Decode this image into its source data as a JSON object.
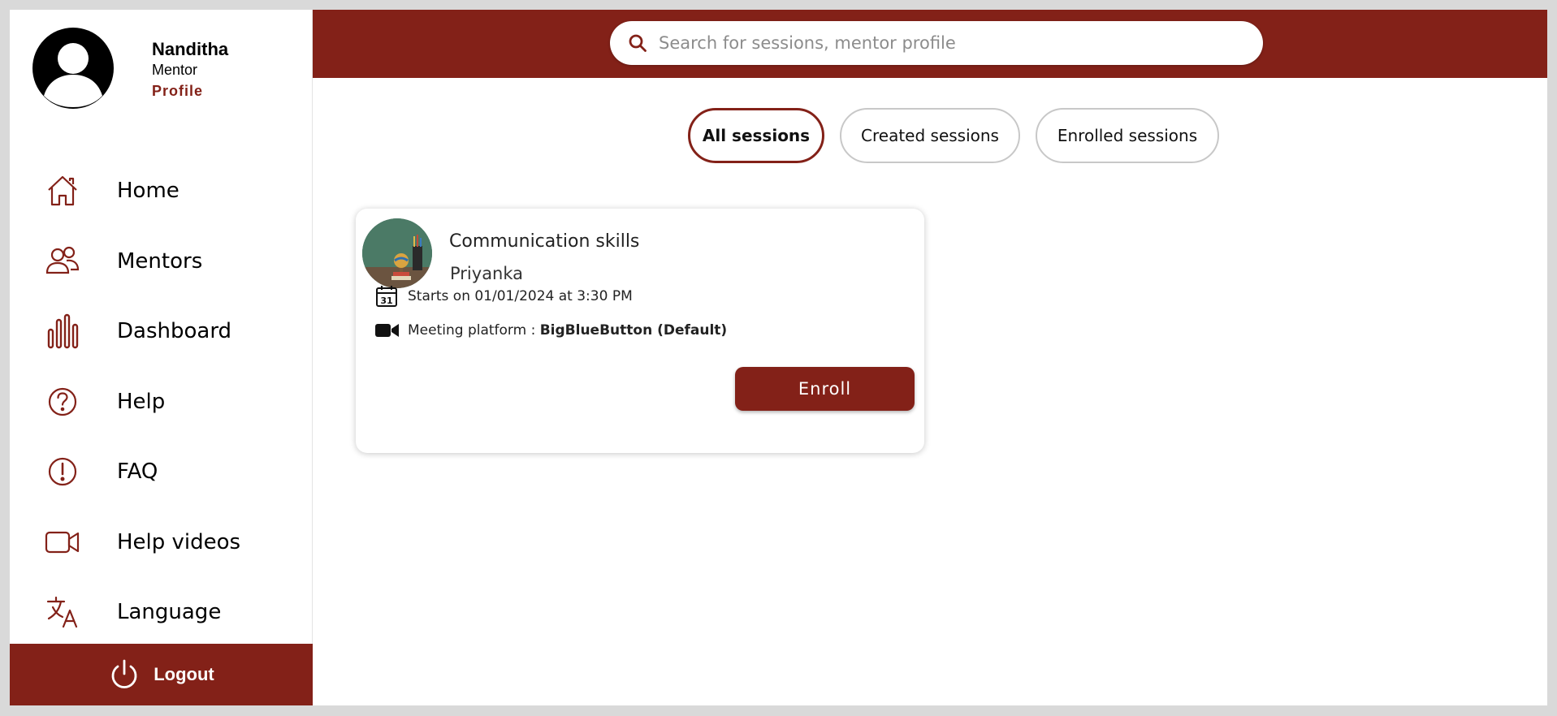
{
  "profile": {
    "name": "Nanditha",
    "role": "Mentor",
    "link": "Profile"
  },
  "nav": {
    "items": [
      {
        "label": "Home",
        "icon": "home-icon"
      },
      {
        "label": "Mentors",
        "icon": "users-icon"
      },
      {
        "label": "Dashboard",
        "icon": "bar-chart-icon"
      },
      {
        "label": "Help",
        "icon": "question-icon"
      },
      {
        "label": "FAQ",
        "icon": "exclamation-icon"
      },
      {
        "label": "Help videos",
        "icon": "video-icon"
      },
      {
        "label": "Language",
        "icon": "translate-icon"
      }
    ],
    "logout": "Logout"
  },
  "search": {
    "placeholder": "Search for sessions, mentor profile",
    "value": ""
  },
  "tabs": [
    {
      "label": "All sessions",
      "active": true
    },
    {
      "label": "Created sessions",
      "active": false
    },
    {
      "label": "Enrolled sessions",
      "active": false
    }
  ],
  "session": {
    "title": "Communication skills",
    "mentor": "Priyanka",
    "starts": "Starts on 01/01/2024 at 3:30 PM",
    "platform_prefix": "Meeting platform :",
    "platform_value": "BigBlueButton (Default)",
    "calendar_day": "31",
    "enroll_label": "Enroll"
  },
  "colors": {
    "brand": "#832118",
    "background": "#ffffff",
    "frame": "#d9d9d9"
  }
}
